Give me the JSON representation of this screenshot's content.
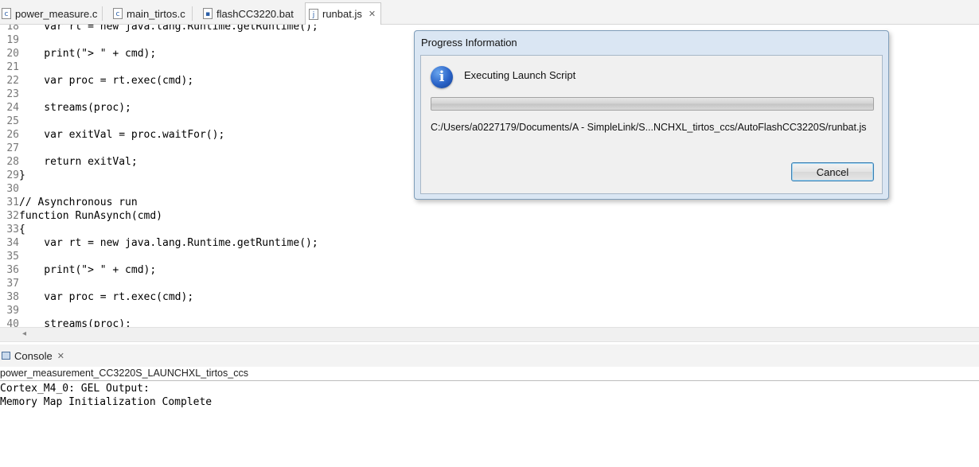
{
  "editor_tabs": [
    {
      "label": "power_measure.c",
      "icon": "c-file-icon",
      "active": false
    },
    {
      "label": "main_tirtos.c",
      "icon": "c-file-icon",
      "active": false
    },
    {
      "label": "flashCC3220.bat",
      "icon": "bat-file-icon",
      "active": false
    },
    {
      "label": "runbat.js",
      "icon": "js-file-icon",
      "active": true,
      "close": "✕"
    }
  ],
  "code_lines": [
    {
      "num": "18",
      "text": "    var rt = new java.lang.Runtime.getRuntime();"
    },
    {
      "num": "19",
      "text": ""
    },
    {
      "num": "20",
      "text": "    print(\"> \" + cmd);"
    },
    {
      "num": "21",
      "text": ""
    },
    {
      "num": "22",
      "text": "    var proc = rt.exec(cmd);"
    },
    {
      "num": "23",
      "text": ""
    },
    {
      "num": "24",
      "text": "    streams(proc);"
    },
    {
      "num": "25",
      "text": ""
    },
    {
      "num": "26",
      "text": "    var exitVal = proc.waitFor();"
    },
    {
      "num": "27",
      "text": ""
    },
    {
      "num": "28",
      "text": "    return exitVal;"
    },
    {
      "num": "29",
      "text": "}"
    },
    {
      "num": "30",
      "text": ""
    },
    {
      "num": "31",
      "text": "// Asynchronous run"
    },
    {
      "num": "32",
      "text": "function RunAsynch(cmd)"
    },
    {
      "num": "33",
      "text": "{"
    },
    {
      "num": "34",
      "text": "    var rt = new java.lang.Runtime.getRuntime();"
    },
    {
      "num": "35",
      "text": ""
    },
    {
      "num": "36",
      "text": "    print(\"> \" + cmd);"
    },
    {
      "num": "37",
      "text": ""
    },
    {
      "num": "38",
      "text": "    var proc = rt.exec(cmd);"
    },
    {
      "num": "39",
      "text": ""
    },
    {
      "num": "40",
      "text": "    streams(proc);"
    }
  ],
  "console": {
    "tab_label": "Console",
    "tab_close": "✕",
    "title": "power_measurement_CC3220S_LAUNCHXL_tirtos_ccs",
    "lines": [
      "Cortex_M4_0: GEL Output:",
      "Memory Map Initialization Complete"
    ]
  },
  "dialog": {
    "title": "Progress Information",
    "icon": "info-icon",
    "icon_glyph": "i",
    "task": "Executing Launch Script",
    "progress": 0,
    "path": "C:/Users/a0227179/Documents/A - SimpleLink/S...NCHXL_tirtos_ccs/AutoFlashCC3220S/runbat.js",
    "cancel_label": "Cancel"
  },
  "colors": {
    "progress_fill": "#5cc24a",
    "dialog_frame": "#dae6f3",
    "button_border": "#3c7fb1"
  }
}
